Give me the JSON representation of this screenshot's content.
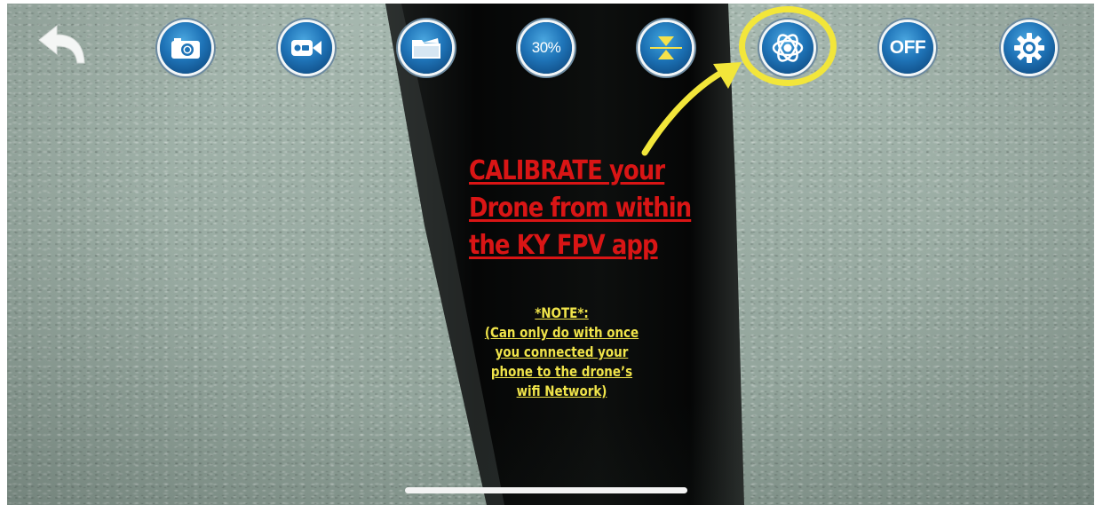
{
  "toolbar": {
    "battery_label": "30%",
    "power_label": "OFF",
    "icons": {
      "back": "back-arrow-icon",
      "photo": "camera-icon",
      "video": "video-camera-icon",
      "gallery": "folder-icon",
      "trim": "trim-adjust-icon",
      "calibrate": "gyro-calibrate-icon",
      "settings": "gear-icon"
    }
  },
  "annotation": {
    "headline": [
      "CALIBRATE your",
      "Drone from within",
      "the KY FPV app"
    ],
    "note": [
      "*NOTE*:",
      "(Can only do with once",
      "you connected your",
      "phone to the drone’s",
      "wifi Network)"
    ]
  },
  "colors": {
    "headline": "#d91515",
    "note": "#f0e44a",
    "highlight": "#f2e63a",
    "button": "#1f74b8"
  }
}
